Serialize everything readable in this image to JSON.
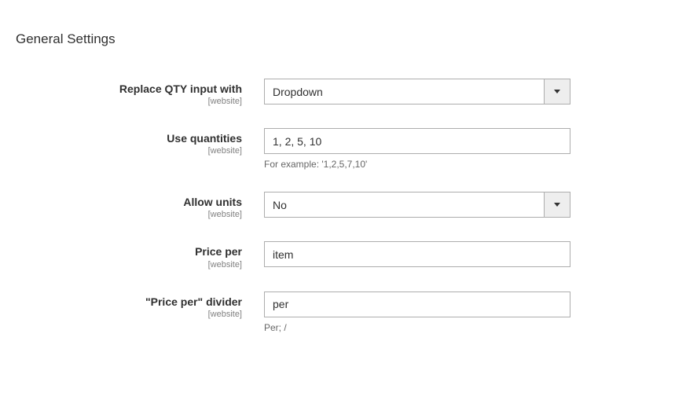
{
  "section_title": "General Settings",
  "fields": {
    "replace_qty": {
      "label": "Replace QTY input with",
      "scope": "[website]",
      "value": "Dropdown"
    },
    "use_quantities": {
      "label": "Use quantities",
      "scope": "[website]",
      "value": "1, 2, 5, 10",
      "hint": "For example: '1,2,5,7,10'"
    },
    "allow_units": {
      "label": "Allow units",
      "scope": "[website]",
      "value": "No"
    },
    "price_per": {
      "label": "Price per",
      "scope": "[website]",
      "value": "item"
    },
    "price_per_divider": {
      "label": "\"Price per\" divider",
      "scope": "[website]",
      "value": "per",
      "hint": "Per; /"
    }
  }
}
